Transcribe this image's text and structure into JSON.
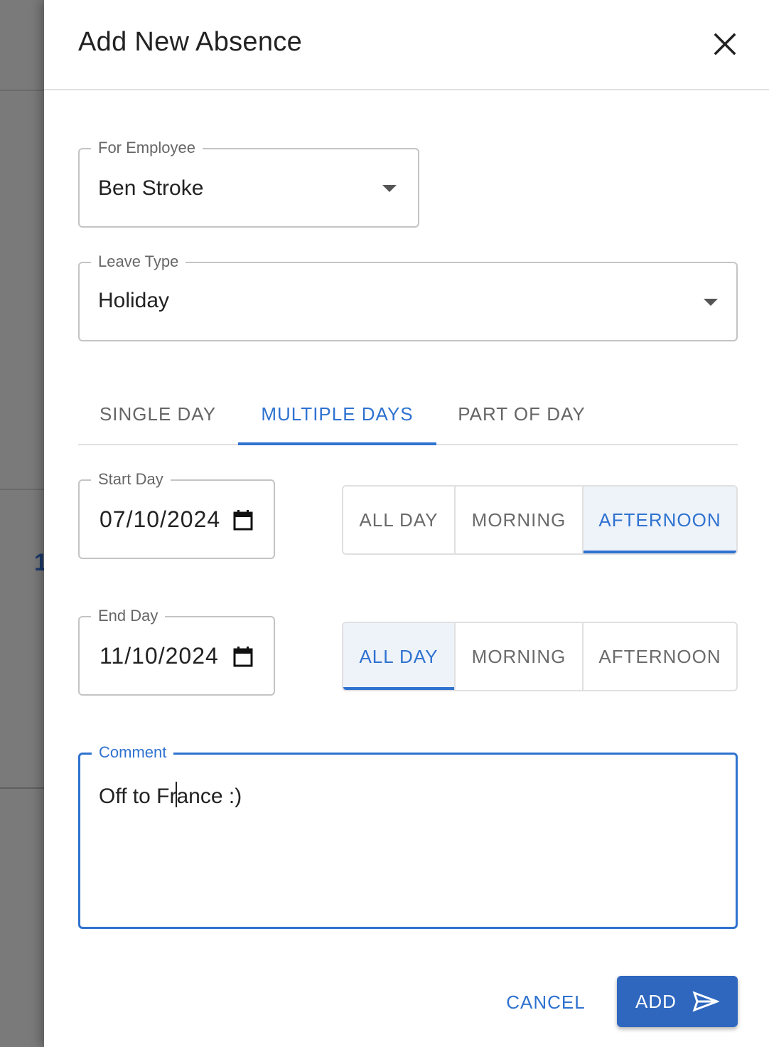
{
  "backdrop": {
    "partial_text": "1"
  },
  "dialog": {
    "title": "Add New Absence",
    "close_icon": "close-icon"
  },
  "employee": {
    "label": "For Employee",
    "value": "Ben Stroke"
  },
  "leave_type": {
    "label": "Leave Type",
    "value": "Holiday"
  },
  "tabs": [
    {
      "label": "SINGLE DAY",
      "active": false
    },
    {
      "label": "MULTIPLE DAYS",
      "active": true
    },
    {
      "label": "PART OF DAY",
      "active": false
    }
  ],
  "start_day": {
    "label": "Start Day",
    "value": "07/10/2024",
    "options": [
      {
        "label": "ALL DAY",
        "selected": false
      },
      {
        "label": "MORNING",
        "selected": false
      },
      {
        "label": "AFTERNOON",
        "selected": true
      }
    ]
  },
  "end_day": {
    "label": "End Day",
    "value": "11/10/2024",
    "options": [
      {
        "label": "ALL DAY",
        "selected": true
      },
      {
        "label": "MORNING",
        "selected": false
      },
      {
        "label": "AFTERNOON",
        "selected": false
      }
    ]
  },
  "comment": {
    "label": "Comment",
    "value_before_cursor": "Off to Fr",
    "value_after_cursor": "ance :)"
  },
  "actions": {
    "cancel_label": "CANCEL",
    "add_label": "ADD",
    "add_icon": "send-icon"
  },
  "colors": {
    "accent": "#2f72d0",
    "primary_button": "#2f67bf",
    "selected_toggle_bg": "#eef3fa"
  }
}
